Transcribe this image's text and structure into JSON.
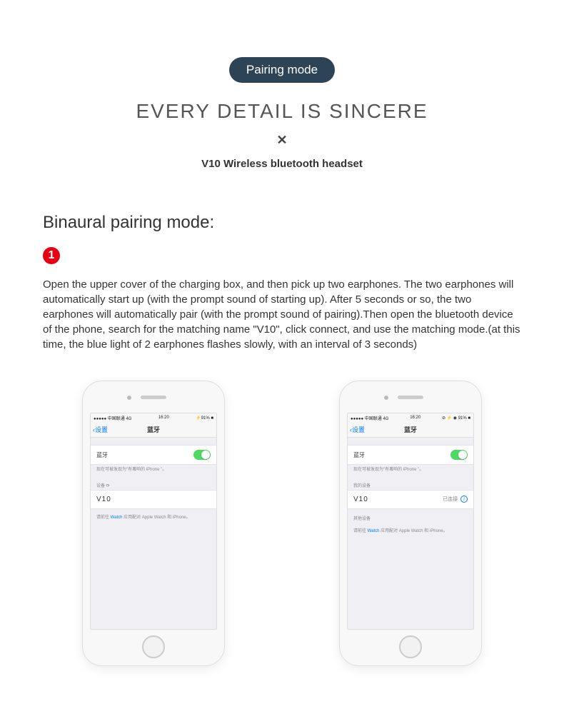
{
  "header": {
    "badge": "Pairing mode",
    "title": "EVERY DETAIL IS SINCERE",
    "cross": "✕",
    "subtitle": "V10  Wireless bluetooth headset"
  },
  "section": {
    "heading": "Binaural pairing mode:",
    "step_number": "1",
    "body": "Open the upper cover of the charging box, and then pick up two earphones. The two earphones will automatically start up (with the prompt sound of starting up). After 5 seconds or so, the two earphones will automatically pair (with the prompt sound of pairing).Then open the bluetooth device of the phone, search for the matching name \"V10\", click connect, and use the matching mode.(at this time, the blue light of 2 earphones flashes slowly, with an interval of 3 seconds)"
  },
  "phone_left": {
    "status": {
      "left": "●●●●● 中国联通 4G",
      "center": "16:20",
      "right": "⚡91% ■"
    },
    "nav": {
      "back": "设置",
      "title": "蓝牙"
    },
    "bt_label": "蓝牙",
    "discover_note": "现在可被发现为\"有毒哟的 iPhone \"。",
    "group_devices": "设备 ⟳",
    "device_name": "V10",
    "watch_note_pre": "请前往 ",
    "watch_link": "Watch",
    "watch_note_post": " 应用配对 Apple Watch 和 iPhone。"
  },
  "phone_right": {
    "status": {
      "left": "●●●●● 中国联通 4G",
      "center": "16:20",
      "right": "⊘ ⚡ ◉ 91% ■"
    },
    "nav": {
      "back": "设置",
      "title": "蓝牙"
    },
    "bt_label": "蓝牙",
    "discover_note": "现在可被发现为\"有毒哟的 iPhone \"。",
    "group_my": "我的设备",
    "device_name": "V10",
    "device_status": "已连接",
    "group_other": "其他设备",
    "watch_note_pre": "请前往 ",
    "watch_link": "Watch",
    "watch_note_post": " 应用配对 Apple Watch 和 iPhone。"
  }
}
